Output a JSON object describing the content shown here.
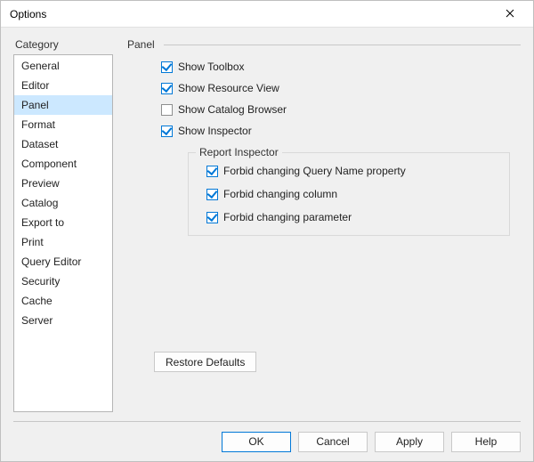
{
  "window": {
    "title": "Options"
  },
  "category": {
    "label": "Category",
    "items": [
      "General",
      "Editor",
      "Panel",
      "Format",
      "Dataset",
      "Component",
      "Preview",
      "Catalog",
      "Export to",
      "Print",
      "Query Editor",
      "Security",
      "Cache",
      "Server"
    ],
    "selected_index": 2
  },
  "panel": {
    "heading": "Panel",
    "checks": {
      "show_toolbox": {
        "label": "Show Toolbox",
        "checked": true
      },
      "show_resource_view": {
        "label": "Show Resource View",
        "checked": true
      },
      "show_catalog_browser": {
        "label": "Show Catalog Browser",
        "checked": false
      },
      "show_inspector": {
        "label": "Show Inspector",
        "checked": true
      }
    },
    "inspector_group": {
      "legend": "Report Inspector",
      "forbid_query_name": {
        "label": "Forbid changing Query Name property",
        "checked": true
      },
      "forbid_column": {
        "label": "Forbid changing column",
        "checked": true
      },
      "forbid_parameter": {
        "label": "Forbid changing parameter",
        "checked": true
      }
    },
    "restore_label": "Restore Defaults"
  },
  "footer": {
    "ok": "OK",
    "cancel": "Cancel",
    "apply": "Apply",
    "help": "Help"
  }
}
